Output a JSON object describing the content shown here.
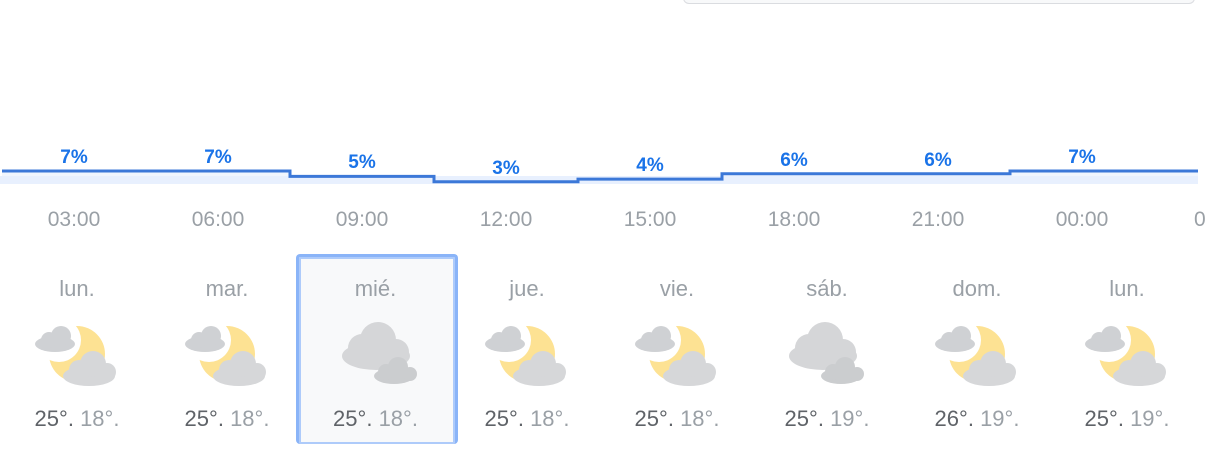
{
  "chart_data": {
    "type": "line",
    "title": "",
    "x": [
      "03:00",
      "06:00",
      "09:00",
      "12:00",
      "15:00",
      "18:00",
      "21:00",
      "00:00"
    ],
    "values": [
      7,
      7,
      5,
      3,
      4,
      6,
      6,
      7
    ],
    "labels": [
      "7%",
      "7%",
      "5%",
      "3%",
      "4%",
      "6%",
      "6%",
      "7%"
    ],
    "series_color": "#3c78d8",
    "xlabel": "",
    "ylabel": ""
  },
  "days": [
    {
      "name": "lun.",
      "max": "25°.",
      "min": "18°.",
      "icon": "moon-cloud-icon",
      "selected": false
    },
    {
      "name": "mar.",
      "max": "25°.",
      "min": "18°.",
      "icon": "moon-cloud-icon",
      "selected": false
    },
    {
      "name": "mié.",
      "max": "25°.",
      "min": "18°.",
      "icon": "cloudy-icon",
      "selected": true
    },
    {
      "name": "jue.",
      "max": "25°.",
      "min": "18°.",
      "icon": "moon-cloud-icon",
      "selected": false
    },
    {
      "name": "vie.",
      "max": "25°.",
      "min": "18°.",
      "icon": "moon-cloud-icon",
      "selected": false
    },
    {
      "name": "sáb.",
      "max": "25°.",
      "min": "19°.",
      "icon": "cloudy-icon",
      "selected": false
    },
    {
      "name": "dom.",
      "max": "26°.",
      "min": "19°.",
      "icon": "moon-cloud-icon",
      "selected": false
    },
    {
      "name": "lun.",
      "max": "25°.",
      "min": "19°.",
      "icon": "moon-cloud-icon",
      "selected": false
    }
  ],
  "colors": {
    "accent": "#1a73e8",
    "line": "#3c78d8",
    "moon": "#fde293",
    "cloud": "#dadce0",
    "selected_border": "#8ab4f8"
  }
}
